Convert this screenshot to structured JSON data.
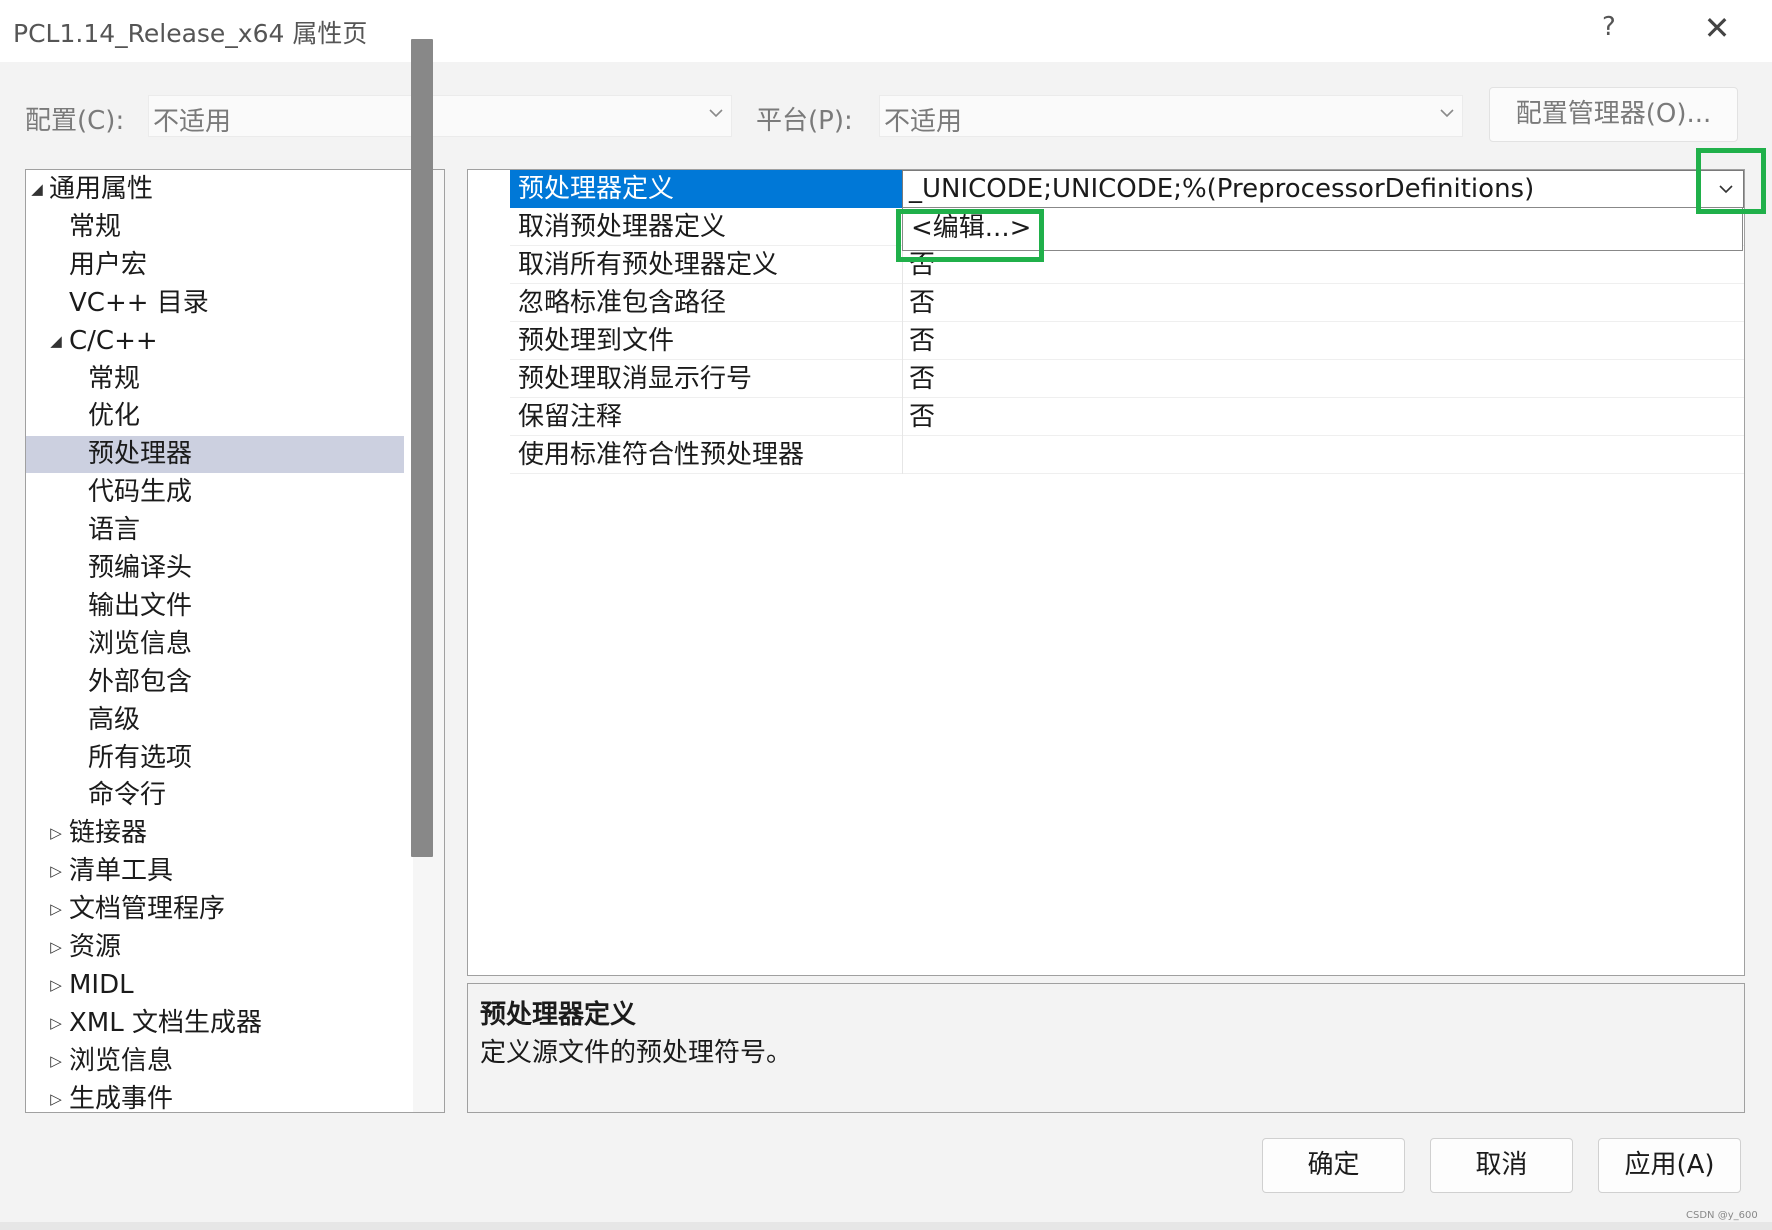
{
  "window": {
    "title": "PCL1.14_Release_x64 属性页",
    "help_glyph": "?",
    "close_glyph": "✕"
  },
  "config": {
    "config_label": "配置(C):",
    "config_value": "不适用",
    "platform_label": "平台(P):",
    "platform_value": "不适用",
    "manager_button": "配置管理器(O)..."
  },
  "tree": {
    "items": [
      {
        "label": "通用属性",
        "toggle": "◢"
      },
      {
        "label": "常规",
        "toggle": ""
      },
      {
        "label": "用户宏",
        "toggle": ""
      },
      {
        "label": "VC++ 目录",
        "toggle": ""
      },
      {
        "label": "C/C++",
        "toggle": "◢"
      },
      {
        "label": "常规",
        "toggle": ""
      },
      {
        "label": "优化",
        "toggle": ""
      },
      {
        "label": "预处理器",
        "toggle": "",
        "selected": true
      },
      {
        "label": "代码生成",
        "toggle": ""
      },
      {
        "label": "语言",
        "toggle": ""
      },
      {
        "label": "预编译头",
        "toggle": ""
      },
      {
        "label": "输出文件",
        "toggle": ""
      },
      {
        "label": "浏览信息",
        "toggle": ""
      },
      {
        "label": "外部包含",
        "toggle": ""
      },
      {
        "label": "高级",
        "toggle": ""
      },
      {
        "label": "所有选项",
        "toggle": ""
      },
      {
        "label": "命令行",
        "toggle": ""
      },
      {
        "label": "链接器",
        "toggle": "▷"
      },
      {
        "label": "清单工具",
        "toggle": "▷"
      },
      {
        "label": "文档管理程序",
        "toggle": "▷"
      },
      {
        "label": "资源",
        "toggle": "▷"
      },
      {
        "label": "MIDL",
        "toggle": "▷"
      },
      {
        "label": "XML 文档生成器",
        "toggle": "▷"
      },
      {
        "label": "浏览信息",
        "toggle": "▷"
      },
      {
        "label": "生成事件",
        "toggle": "▷"
      }
    ]
  },
  "grid": {
    "rows": [
      {
        "name": "预处理器定义",
        "value": "_UNICODE;UNICODE;%(PreprocessorDefinitions)",
        "selected": true
      },
      {
        "name": "取消预处理器定义",
        "value": ""
      },
      {
        "name": "取消所有预处理器定义",
        "value": "否"
      },
      {
        "name": "忽略标准包含路径",
        "value": "否"
      },
      {
        "name": "预处理到文件",
        "value": "否"
      },
      {
        "name": "预处理取消显示行号",
        "value": "否"
      },
      {
        "name": "保留注释",
        "value": "否"
      },
      {
        "name": "使用标准符合性预处理器",
        "value": ""
      }
    ],
    "dropdown_option": "<编辑...>"
  },
  "description": {
    "title": "预处理器定义",
    "text": "定义源文件的预处理符号。"
  },
  "buttons": {
    "ok": "确定",
    "cancel": "取消",
    "apply": "应用(A)"
  },
  "watermark": "CSDN @y_600",
  "colors": {
    "selection_blue": "#0078d7",
    "tree_selected": "#ccd0e0",
    "highlight_green": "#20b04a"
  }
}
